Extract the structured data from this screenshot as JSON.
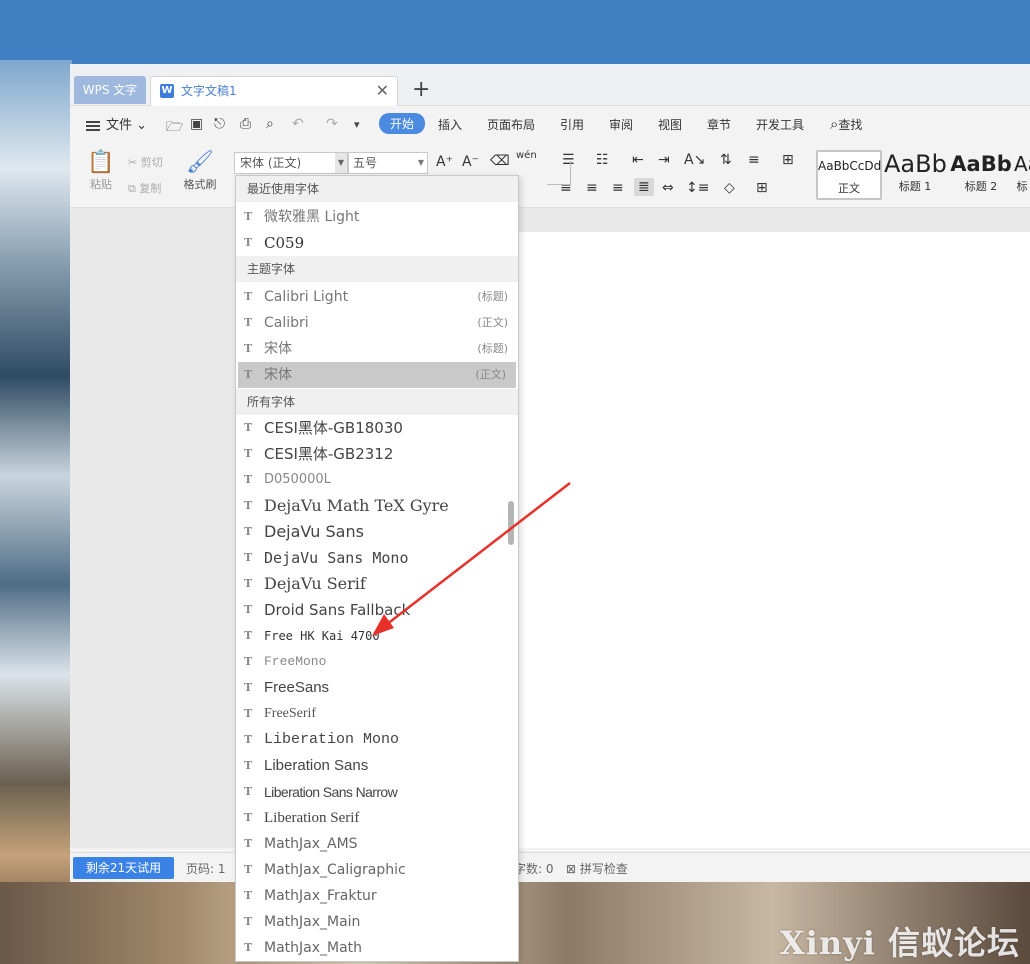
{
  "window": {
    "app_tab": "WPS 文字",
    "doc_tab": "文字文稿1",
    "add_tab": "+"
  },
  "menubar": {
    "file": "文件",
    "tabs": [
      "开始",
      "插入",
      "页面布局",
      "引用",
      "审阅",
      "视图",
      "章节",
      "开发工具"
    ],
    "active_tab": "开始",
    "search": "查找"
  },
  "toolbar": {
    "paste": "粘贴",
    "cut": "剪切",
    "copy": "复制",
    "format_painter": "格式刷",
    "font_name": "宋体 (正文)",
    "font_size": "五号",
    "phonetic": "wén",
    "styles": [
      {
        "sample": "AaBbCcDd",
        "name": "正文"
      },
      {
        "sample": "AaBb",
        "name": "标题 1"
      },
      {
        "sample": "AaBb",
        "name": "标题 2"
      },
      {
        "sample": "Aa",
        "name": "标"
      }
    ]
  },
  "font_dropdown": {
    "sections": {
      "recent": "最近使用字体",
      "theme": "主题字体",
      "all": "所有字体"
    },
    "recent": [
      "微软雅黑 Light",
      "C059"
    ],
    "theme": [
      {
        "name": "Calibri Light",
        "tag": "(标题)"
      },
      {
        "name": "Calibri",
        "tag": "(正文)"
      },
      {
        "name": "宋体",
        "tag": "(标题)"
      },
      {
        "name": "宋体",
        "tag": "(正文)"
      }
    ],
    "all": [
      "CESI黑体-GB18030",
      "CESI黑体-GB2312",
      "D050000L",
      "DejaVu Math TeX Gyre",
      "DejaVu Sans",
      "DejaVu Sans Mono",
      "DejaVu Serif",
      "Droid Sans Fallback",
      "Free HK Kai 4700",
      "FreeMono",
      "FreeSans",
      "FreeSerif",
      "Liberation Mono",
      "Liberation Sans",
      "Liberation Sans Narrow",
      "Liberation Serif",
      "MathJax_AMS",
      "MathJax_Caligraphic",
      "MathJax_Fraktur",
      "MathJax_Main",
      "MathJax_Math"
    ]
  },
  "statusbar": {
    "trial": "剩余21天试用",
    "page": "页码: 1",
    "word_count": "字数: 0",
    "spell_check": "拼写检查"
  },
  "watermark": "Xinyi 信蚁论坛",
  "colors": {
    "accent": "#4a8ae0",
    "trial_button": "#3b82e6",
    "arrow": "#e8302a"
  }
}
